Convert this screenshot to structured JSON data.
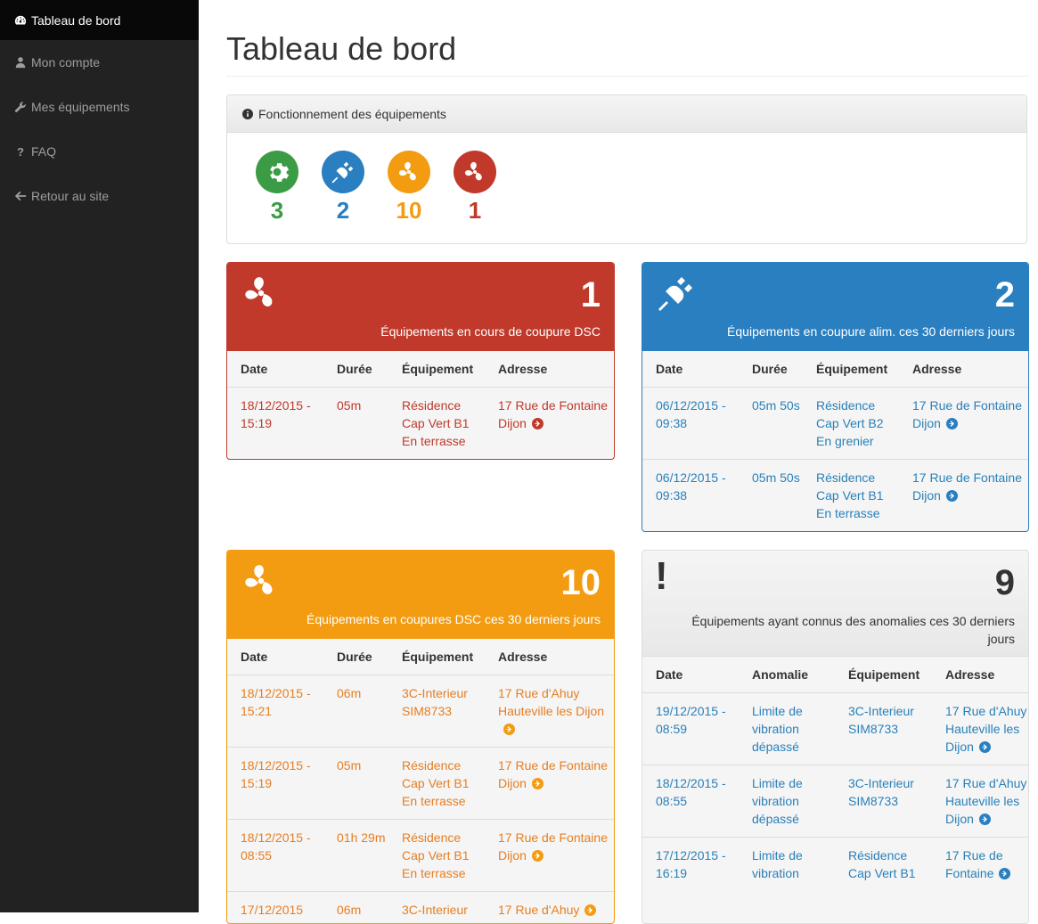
{
  "sidebar": {
    "items": [
      {
        "label": "Tableau de bord",
        "icon": "dashboard-icon",
        "active": true
      },
      {
        "label": "Mon compte",
        "icon": "user-icon",
        "active": false
      },
      {
        "label": "Mes équipements",
        "icon": "wrench-icon",
        "active": false
      },
      {
        "label": "FAQ",
        "icon": "question-icon",
        "active": false
      },
      {
        "label": "Retour au site",
        "icon": "arrow-left-icon",
        "active": false
      }
    ]
  },
  "page": {
    "title": "Tableau de bord"
  },
  "status": {
    "heading": "Fonctionnement des équipements",
    "stats": [
      {
        "icon": "gear-icon",
        "value": "3",
        "color": "#3c9c45"
      },
      {
        "icon": "plug-icon",
        "value": "2",
        "color": "#2a7fc0"
      },
      {
        "icon": "fan-icon",
        "value": "10",
        "color": "#f39c12"
      },
      {
        "icon": "fan-icon",
        "value": "1",
        "color": "#c0392b"
      }
    ]
  },
  "cards": {
    "dsc_current": {
      "count": "1",
      "label": "Équipements en cours de coupure DSC",
      "color": "#c0392b",
      "headers": [
        "Date",
        "Durée",
        "Équipement",
        "Adresse"
      ],
      "rows": [
        [
          "18/12/2015 - 15:19",
          "05m",
          "Résidence Cap Vert B1 En terrasse",
          "17 Rue de Fontaine Dijon"
        ]
      ]
    },
    "power_cut": {
      "count": "2",
      "label": "Équipements en coupure alim. ces 30 derniers jours",
      "color": "#2a7fc0",
      "headers": [
        "Date",
        "Durée",
        "Équipement",
        "Adresse"
      ],
      "rows": [
        [
          "06/12/2015 - 09:38",
          "05m 50s",
          "Résidence Cap Vert B2 En grenier",
          "17 Rue de Fontaine Dijon"
        ],
        [
          "06/12/2015 - 09:38",
          "05m 50s",
          "Résidence Cap Vert B1 En terrasse",
          "17 Rue de Fontaine Dijon"
        ]
      ]
    },
    "dsc_30": {
      "count": "10",
      "label": "Équipements en coupures DSC ces 30 derniers jours",
      "color": "#f39c12",
      "headers": [
        "Date",
        "Durée",
        "Équipement",
        "Adresse"
      ],
      "rows": [
        [
          "18/12/2015 - 15:21",
          "06m",
          "3C-Interieur SIM8733",
          "17 Rue d'Ahuy Hauteville les Dijon"
        ],
        [
          "18/12/2015 - 15:19",
          "05m",
          "Résidence Cap Vert B1 En terrasse",
          "17 Rue de Fontaine Dijon"
        ],
        [
          "18/12/2015 - 08:55",
          "01h 29m",
          "Résidence Cap Vert B1 En terrasse",
          "17 Rue de Fontaine Dijon"
        ],
        [
          "17/12/2015",
          "06m",
          "3C-Interieur",
          "17 Rue d'Ahuy"
        ]
      ]
    },
    "anomalies": {
      "count": "9",
      "label": "Équipements ayant connus des anomalies ces 30 derniers jours",
      "headers": [
        "Date",
        "Anomalie",
        "Équipement",
        "Adresse"
      ],
      "rows": [
        [
          "19/12/2015 - 08:59",
          "Limite de vibration dépassé",
          "3C-Interieur SIM8733",
          "17 Rue d'Ahuy Hauteville les Dijon"
        ],
        [
          "18/12/2015 - 08:55",
          "Limite de vibration dépassé",
          "3C-Interieur SIM8733",
          "17 Rue d'Ahuy Hauteville les Dijon"
        ],
        [
          "17/12/2015 - 16:19",
          "Limite de vibration",
          "Résidence Cap Vert B1",
          "17 Rue de Fontaine"
        ]
      ]
    }
  }
}
